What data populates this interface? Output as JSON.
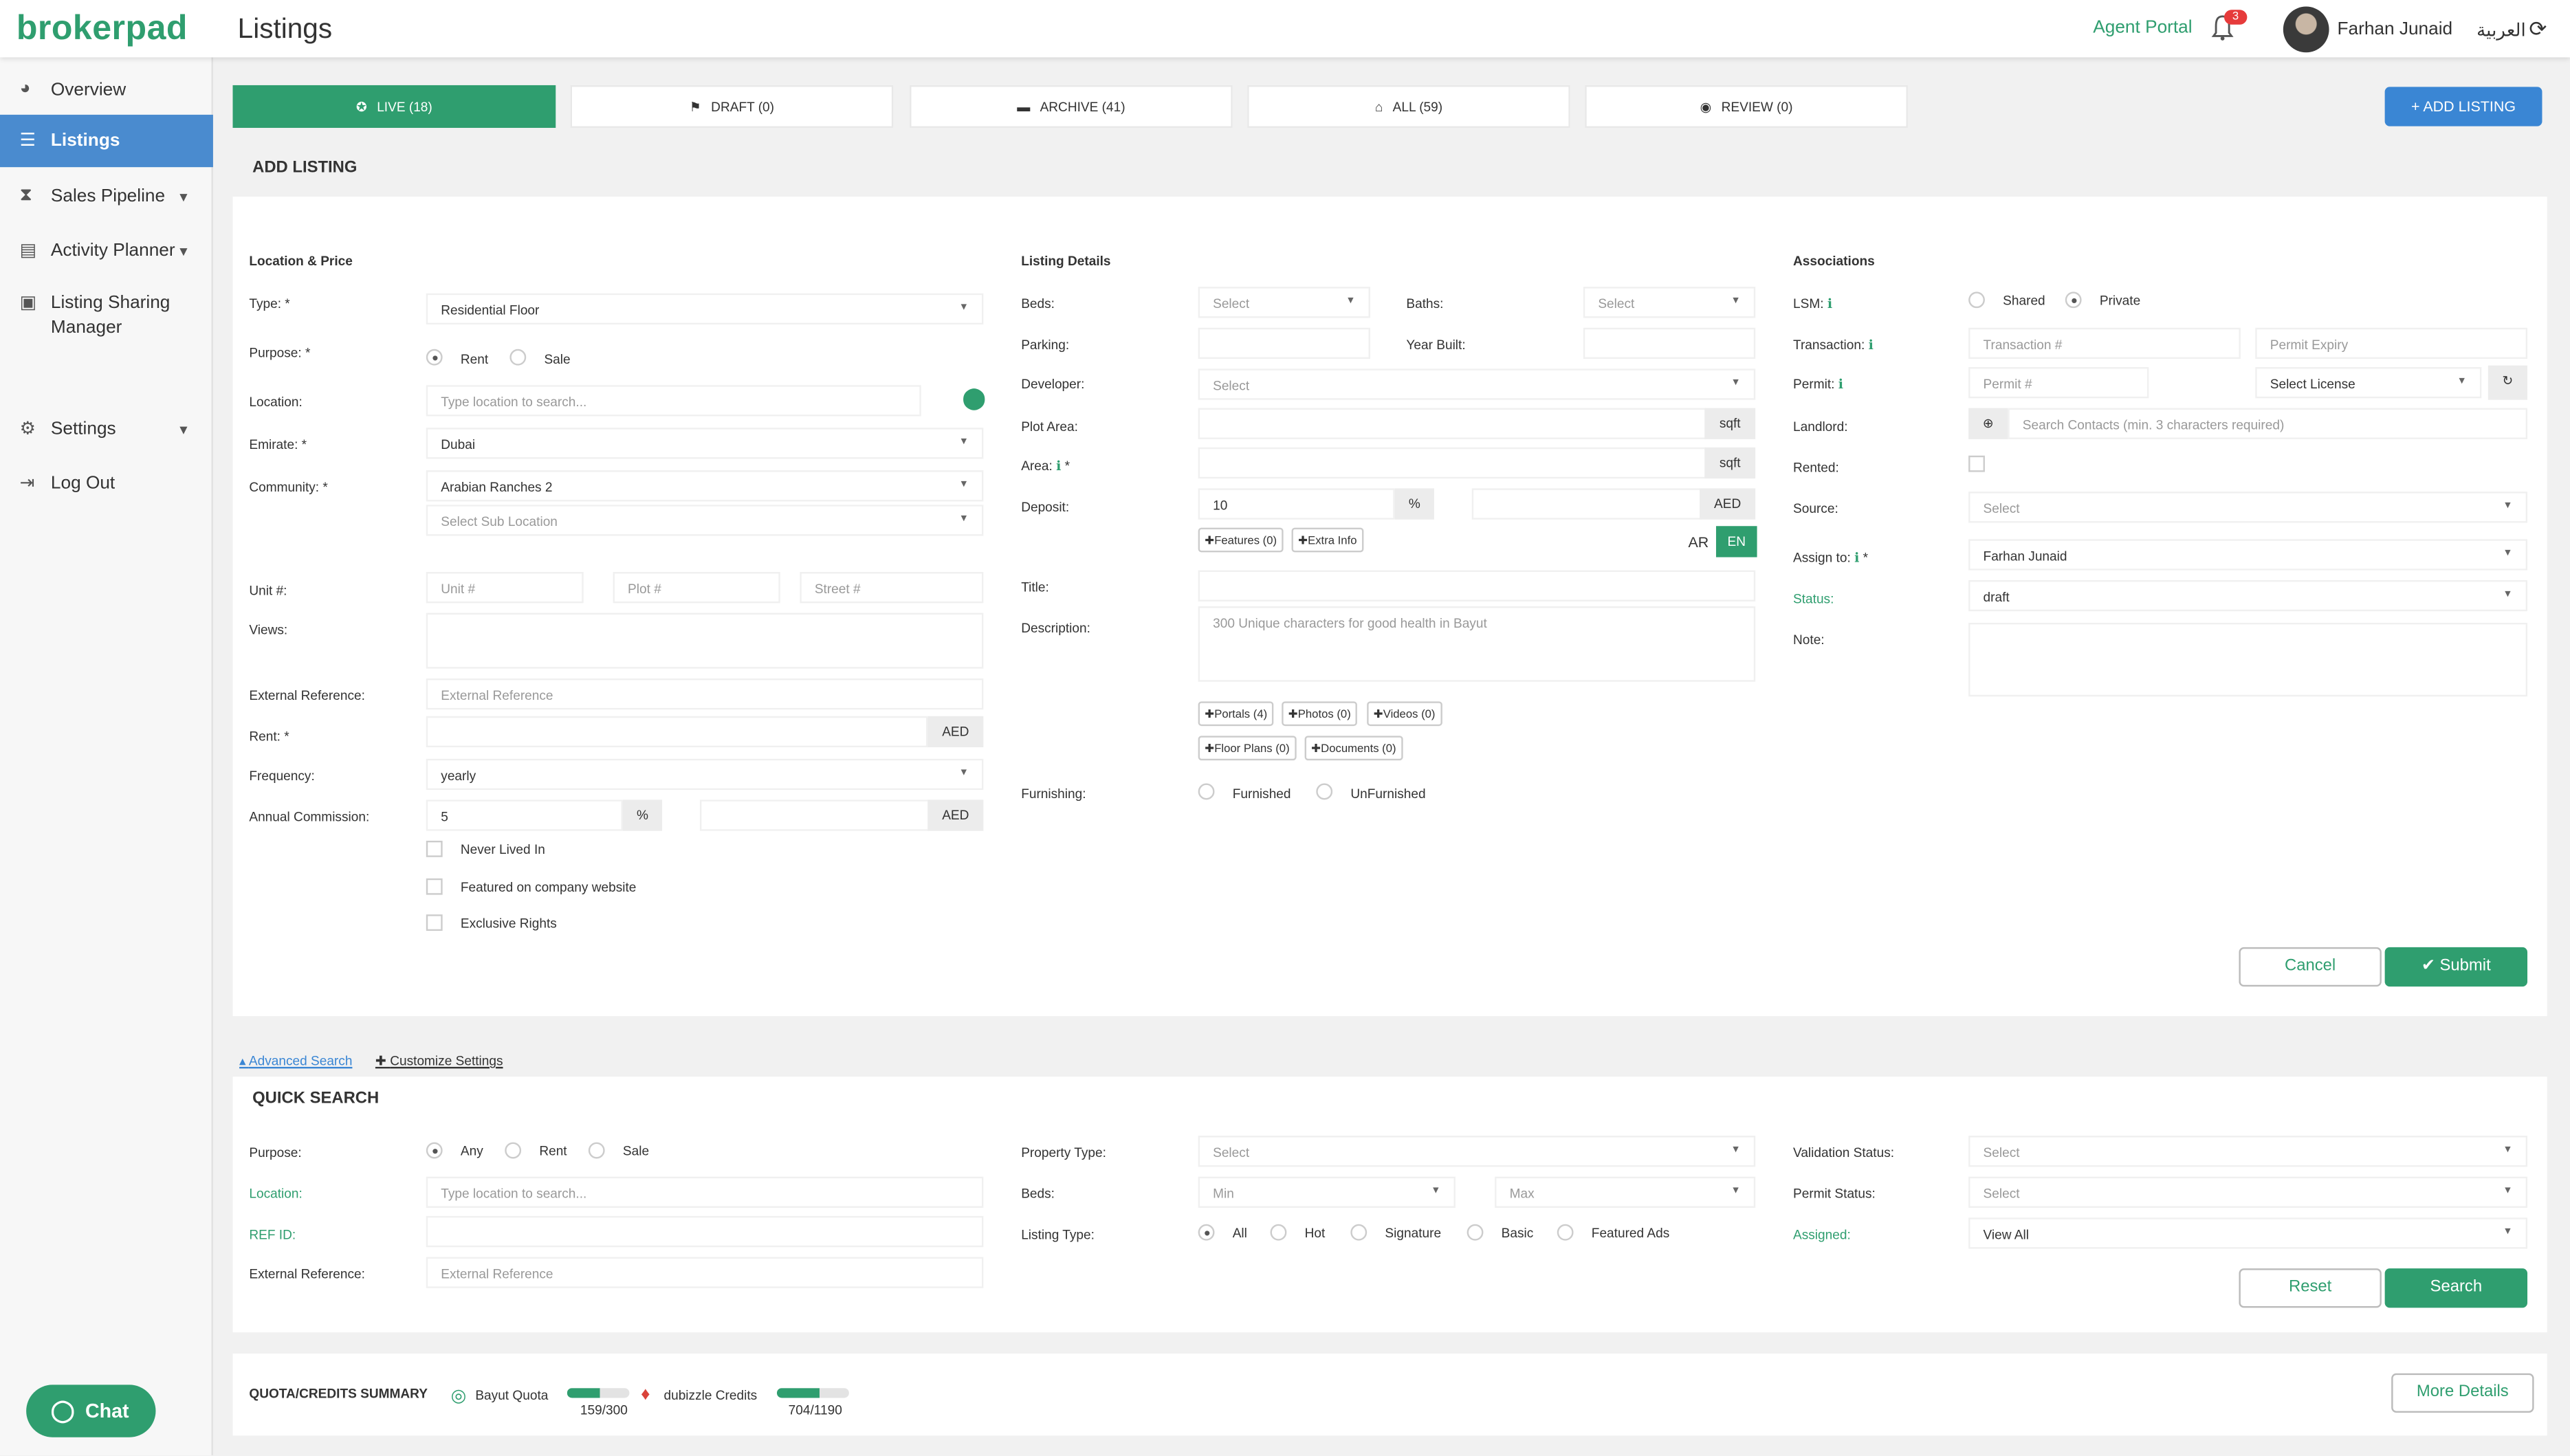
{
  "app": {
    "logo": "brokerpad",
    "page_title": "Listings"
  },
  "topbar": {
    "agent_portal": "Agent Portal",
    "notifications": "3",
    "user_name": "Farhan Junaid",
    "language": "العربية"
  },
  "sidebar": {
    "items": [
      {
        "label": "Overview",
        "icon": "dashboard-icon"
      },
      {
        "label": "Listings",
        "icon": "list-icon",
        "active": true
      },
      {
        "label": "Sales Pipeline",
        "icon": "hourglass-icon"
      },
      {
        "label": "Activity Planner",
        "icon": "calendar-icon"
      },
      {
        "label": "Listing Sharing",
        "label2": "Manager",
        "icon": "share-icon"
      },
      {
        "label": "Settings",
        "icon": "gear-icon"
      },
      {
        "label": "Log Out",
        "icon": "logout-icon"
      }
    ],
    "chat_label": "Chat"
  },
  "tabs": [
    {
      "label": "LIVE (18)",
      "icon": "live-icon"
    },
    {
      "label": "DRAFT (0)",
      "icon": "flag-icon"
    },
    {
      "label": "ARCHIVE (41)",
      "icon": "archive-icon"
    },
    {
      "label": "ALL (59)",
      "icon": "home-icon"
    },
    {
      "label": "REVIEW (0)",
      "icon": "eye-icon"
    }
  ],
  "add_listing_button": "ADD LISTING",
  "form": {
    "title": "ADD LISTING",
    "location_price": {
      "section": "Location & Price",
      "type_label": "Type: *",
      "type_value": "Residential Floor",
      "purpose_label": "Purpose: *",
      "purpose_rent": "Rent",
      "purpose_sale": "Sale",
      "location_label": "Location:",
      "location_placeholder": "Type location to search...",
      "emirate_label": "Emirate: *",
      "emirate_value": "Dubai",
      "community_label": "Community: *",
      "community_value": "Arabian Ranches 2",
      "sub_location_placeholder": "Select Sub Location",
      "unit_label": "Unit #:",
      "unit_placeholder": "Unit #",
      "plot_placeholder": "Plot #",
      "street_placeholder": "Street #",
      "views_label": "Views:",
      "ext_ref_label": "External Reference:",
      "ext_ref_placeholder": "External Reference",
      "rent_label": "Rent: *",
      "currency": "AED",
      "frequency_label": "Frequency:",
      "frequency_value": "yearly",
      "commission_label": "Annual Commission:",
      "commission_value": "5",
      "percent": "%",
      "never_lived": "Never Lived In",
      "featured_company": "Featured on company website",
      "exclusive": "Exclusive Rights"
    },
    "listing_details": {
      "section": "Listing Details",
      "beds_label": "Beds:",
      "baths_label": "Baths:",
      "select": "Select",
      "parking_label": "Parking:",
      "year_built_label": "Year Built:",
      "developer_label": "Developer:",
      "plot_area_label": "Plot Area:",
      "sqft": "sqft",
      "area_label": "Area:",
      "deposit_label": "Deposit:",
      "deposit_value": "10",
      "features_btn": "Features (0)",
      "extra_info_btn": "Extra Info",
      "lang_ar": "AR",
      "lang_en": "EN",
      "title_label": "Title:",
      "description_label": "Description:",
      "description_placeholder": "300 Unique characters for good health in Bayut",
      "portals_btn": "Portals (4)",
      "photos_btn": "Photos (0)",
      "videos_btn": "Videos (0)",
      "floor_plans_btn": "Floor Plans (0)",
      "documents_btn": "Documents (0)",
      "furnishing_label": "Furnishing:",
      "furnished": "Furnished",
      "unfurnished": "UnFurnished"
    },
    "associations": {
      "section": "Associations",
      "lsm_label": "LSM:",
      "shared": "Shared",
      "private": "Private",
      "transaction_label": "Transaction:",
      "transaction_placeholder": "Transaction #",
      "permit_expiry_placeholder": "Permit Expiry",
      "permit_label": "Permit:",
      "permit_placeholder": "Permit #",
      "select_license": "Select License",
      "landlord_label": "Landlord:",
      "contacts_placeholder": "Search Contacts (min. 3 characters required)",
      "rented_label": "Rented:",
      "source_label": "Source:",
      "source_value": "Select",
      "assign_label": "Assign to:",
      "assign_value": "Farhan Junaid",
      "status_label": "Status:",
      "status_value": "draft",
      "note_label": "Note:"
    },
    "cancel": "Cancel",
    "submit": "Submit"
  },
  "links": {
    "advanced_search": "Advanced Search",
    "customize_settings": "Customize Settings"
  },
  "quick_search": {
    "title": "QUICK SEARCH",
    "purpose_label": "Purpose:",
    "any": "Any",
    "rent": "Rent",
    "sale": "Sale",
    "location_label": "Location:",
    "location_placeholder": "Type location to search...",
    "ref_label": "REF ID:",
    "ext_ref_label": "External Reference:",
    "ext_ref_placeholder": "External Reference",
    "property_type_label": "Property Type:",
    "select": "Select",
    "beds_label": "Beds:",
    "min": "Min",
    "max": "Max",
    "listing_type_label": "Listing Type:",
    "all": "All",
    "hot": "Hot",
    "signature": "Signature",
    "basic": "Basic",
    "featured_ads": "Featured Ads",
    "validation_label": "Validation Status:",
    "permit_status_label": "Permit Status:",
    "assigned_label": "Assigned:",
    "assigned_value": "View All",
    "reset": "Reset",
    "search": "Search"
  },
  "quota": {
    "title": "QUOTA/CREDITS SUMMARY",
    "bayut_label": "Bayut Quota",
    "bayut_value": "159/300",
    "bayut_fraction": 0.53,
    "dubizzle_label": "dubizzle Credits",
    "dubizzle_value": "704/1190",
    "dubizzle_fraction": 0.59,
    "more_details": "More Details"
  }
}
